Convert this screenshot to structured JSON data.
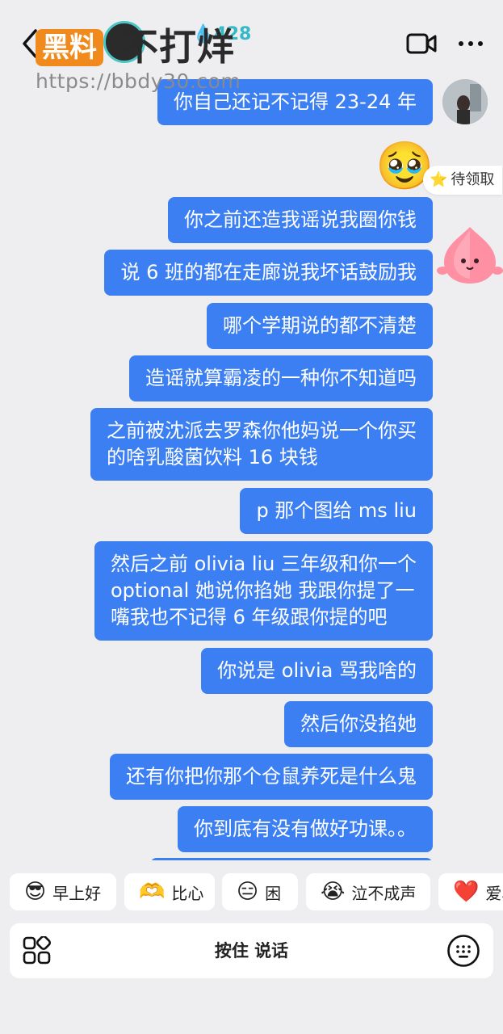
{
  "header": {
    "streak_count": "428",
    "watermark_logo": "黑料",
    "watermark_text": "不打烊",
    "watermark_url": "https://bbdy30.com"
  },
  "messages": [
    {
      "text": "你自己还记不记得 23-24 年"
    },
    {
      "text": "你之前还造我谣说我圈你钱"
    },
    {
      "text": "说 6 班的都在走廊说我坏话鼓励我"
    },
    {
      "text": "哪个学期说的都不清楚"
    },
    {
      "text": "造谣就算霸凌的一种你不知道吗"
    },
    {
      "line1": "之前被沈派去罗森你他妈说一个你买",
      "line2": "的啥乳酸菌饮料 16 块钱"
    },
    {
      "text": "p 那个图给 ms liu"
    },
    {
      "line1": "然后之前 olivia liu 三年级和你一个",
      "line2": "optional 她说你掐她 我跟你提了一",
      "line3": "嘴我也不记得 6 年级跟你提的吧"
    },
    {
      "text": "你说是 olivia 骂我啥的"
    },
    {
      "text": "然后你没掐她"
    },
    {
      "text": "还有你把你那个仓鼠养死是什么鬼"
    },
    {
      "text": "你到底有没有做好功课。。"
    }
  ],
  "sticker_emoji": "🥹",
  "pending_chip": {
    "icon": "⭐",
    "label": "待领取"
  },
  "quick_replies": [
    {
      "icon": "😎",
      "label": "早上好"
    },
    {
      "icon": "🫶",
      "label": "比心"
    },
    {
      "icon": "😑",
      "label": "困"
    },
    {
      "icon": "😭",
      "label": "泣不成声"
    },
    {
      "icon": "❤️",
      "label": "爱心"
    }
  ],
  "input": {
    "hold_to_talk": "按住 说话"
  },
  "colors": {
    "bubble": "#3c7ff2",
    "background": "#eeeef0",
    "accent_teal": "#36b9c6"
  }
}
